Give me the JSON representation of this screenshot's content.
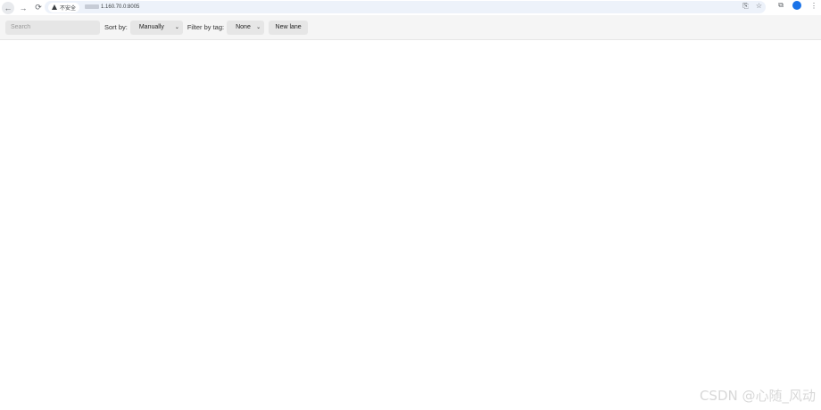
{
  "browser": {
    "back_icon": "arrow-left-icon",
    "forward_icon": "arrow-right-icon",
    "reload_icon": "reload-icon",
    "security_label": "不安全",
    "url": "1.160.70.0:8005",
    "translate_icon": "translate-icon",
    "bookmark_icon": "star-icon",
    "extensions_icon": "puzzle-icon",
    "profile_icon": "profile-icon",
    "menu_icon": "kebab-menu-icon"
  },
  "toolbar": {
    "search_placeholder": "Search",
    "sort_label": "Sort by:",
    "sort_value": "Manually",
    "filter_label": "Filter by tag:",
    "filter_value": "None",
    "new_lane_label": "New lane"
  },
  "watermark": "CSDN @心随_风动"
}
